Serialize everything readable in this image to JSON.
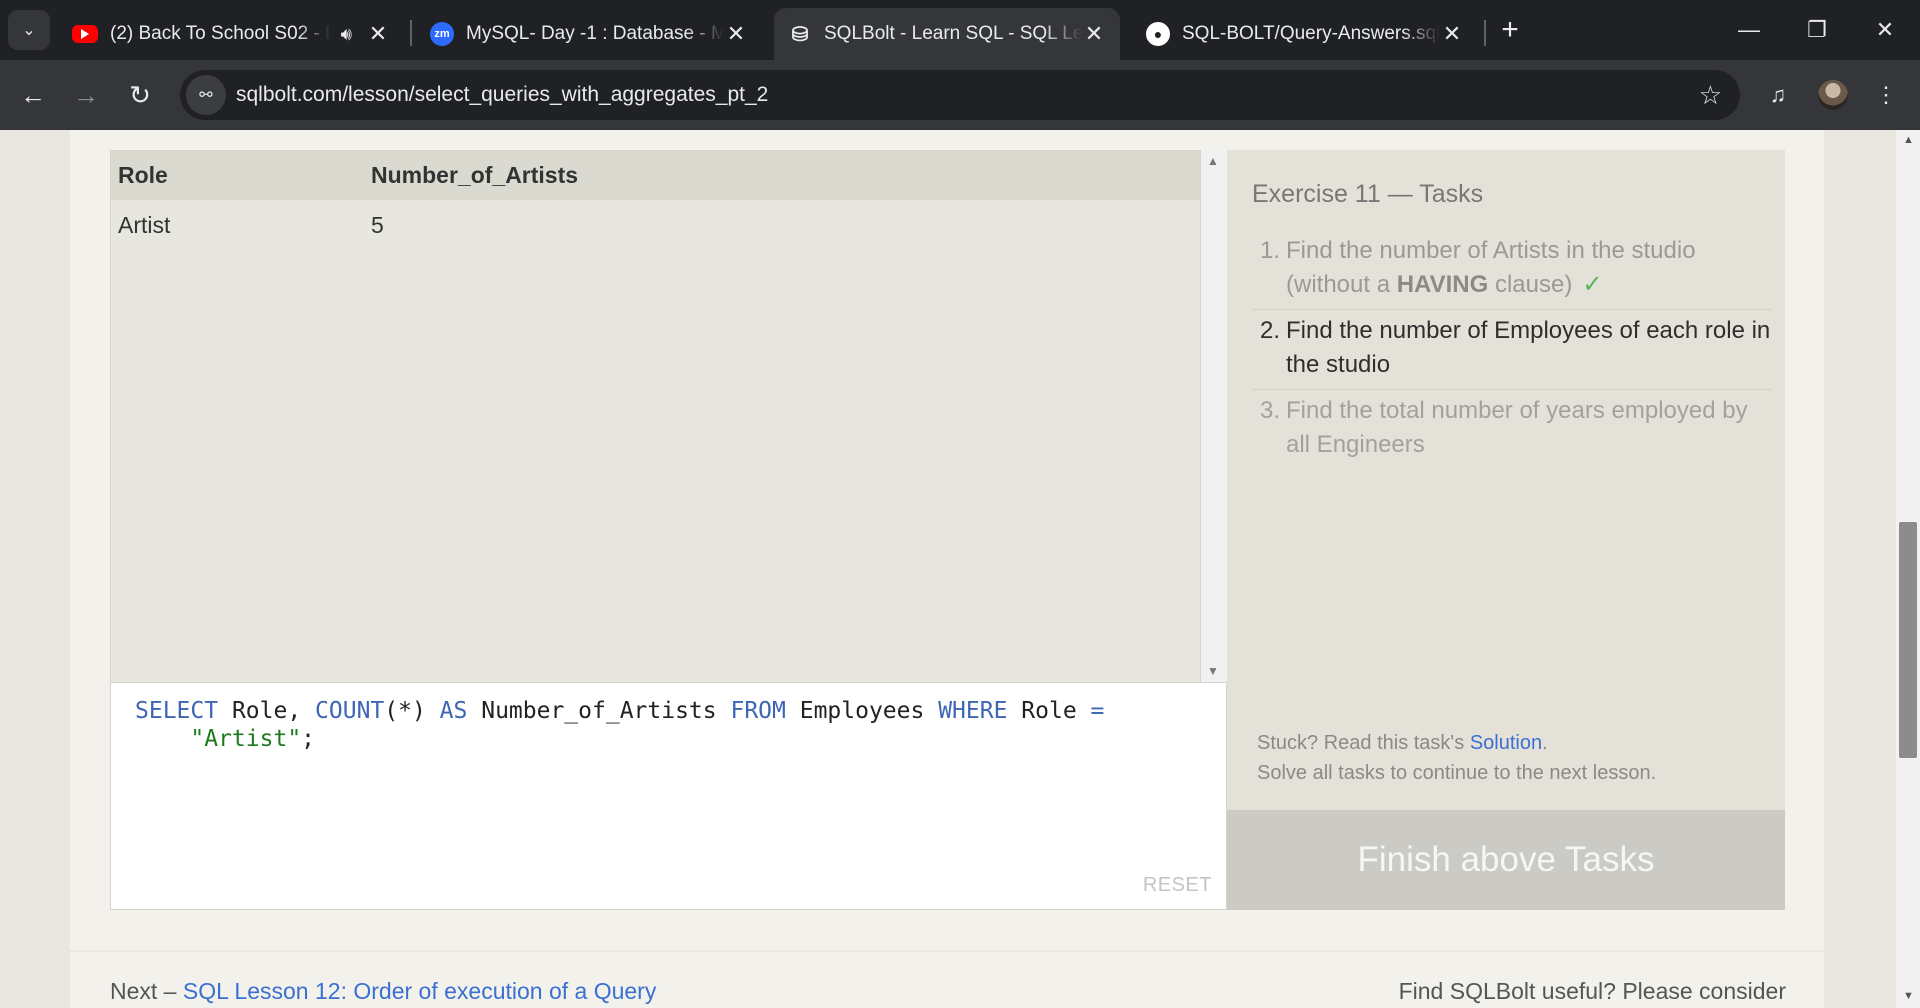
{
  "browser": {
    "tabs": [
      {
        "title": "(2) Back To School S02 - Ep",
        "favicon": "youtube-icon",
        "audible": true
      },
      {
        "title": "MySQL- Day -1 : Database - My",
        "favicon": "zoom-icon"
      },
      {
        "title": "SQLBolt - Learn SQL - SQL Less",
        "favicon": "database-icon",
        "active": true
      },
      {
        "title": "SQL-BOLT/Query-Answers.sql a",
        "favicon": "github-icon"
      }
    ],
    "url": "sqlbolt.com/lesson/select_queries_with_aggregates_pt_2"
  },
  "results": {
    "columns": [
      "Role",
      "Number_of_Artists"
    ],
    "rows": [
      [
        "Artist",
        "5"
      ]
    ]
  },
  "editor": {
    "code": {
      "kw_select": "SELECT",
      "t1": " Role, ",
      "kw_count": "COUNT",
      "t2": "(*) ",
      "kw_as": "AS",
      "t3": " Number_of_Artists ",
      "kw_from": "FROM",
      "t4": " Employees ",
      "kw_where": "WHERE",
      "t5": " Role ",
      "op_eq": "=",
      "indent": "    ",
      "str_value": "\"Artist\"",
      "semicolon": ";"
    },
    "reset_label": "RESET"
  },
  "tasks": {
    "title": "Exercise 11 — Tasks",
    "items": [
      {
        "num": "1.",
        "text_a": "Find the number of Artists in the studio (without a ",
        "bold": "HAVING",
        "text_b": " clause)",
        "check": "✓",
        "state": "done"
      },
      {
        "num": "2.",
        "text": "Find the number of Employees of each role in the studio",
        "state": "current"
      },
      {
        "num": "3.",
        "text": "Find the total number of years employed by all Engineers",
        "state": "pending"
      }
    ],
    "stuck_prefix": "Stuck? Read this task's ",
    "solution_link": "Solution",
    "stuck_suffix": ".",
    "solve_all": "Solve all tasks to continue to the next lesson.",
    "finish_button": "Finish above Tasks"
  },
  "footer": {
    "next_prefix": "Next – ",
    "next_link": "SQL Lesson 12: Order of execution of a Query",
    "useful": "Find SQLBolt useful? Please consider"
  }
}
